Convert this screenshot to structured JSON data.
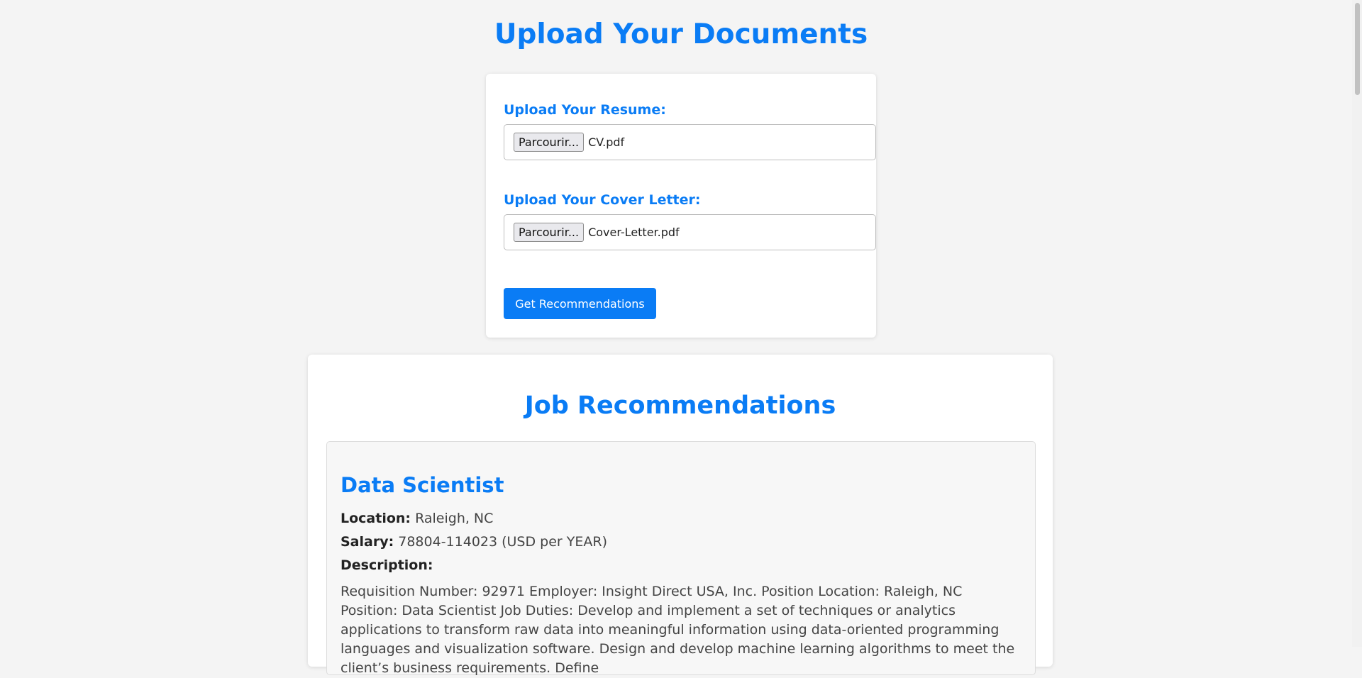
{
  "page": {
    "title": "Upload Your Documents"
  },
  "upload": {
    "resume_label": "Upload Your Resume:",
    "resume_browse": "Parcourir...",
    "resume_file": "CV.pdf",
    "cover_label": "Upload Your Cover Letter:",
    "cover_browse": "Parcourir...",
    "cover_file": "Cover-Letter.pdf",
    "submit_label": "Get Recommendations"
  },
  "results": {
    "title": "Job Recommendations",
    "jobs": [
      {
        "title": "Data Scientist",
        "location_label": "Location:",
        "location": "Raleigh, NC",
        "salary_label": "Salary:",
        "salary": "78804-114023 (USD per YEAR)",
        "description_label": "Description:",
        "description": "Requisition Number: 92971 Employer: Insight Direct USA, Inc. Position Location: Raleigh, NC Position: Data Scientist Job Duties: Develop and implement a set of techniques or analytics applications to transform raw data into meaningful information using data-oriented programming languages and visualization software. Design and develop machine learning algorithms to meet the client’s business requirements. Define"
      }
    ]
  },
  "colors": {
    "accent": "#0a7cf5",
    "background": "#f4f4f4"
  }
}
